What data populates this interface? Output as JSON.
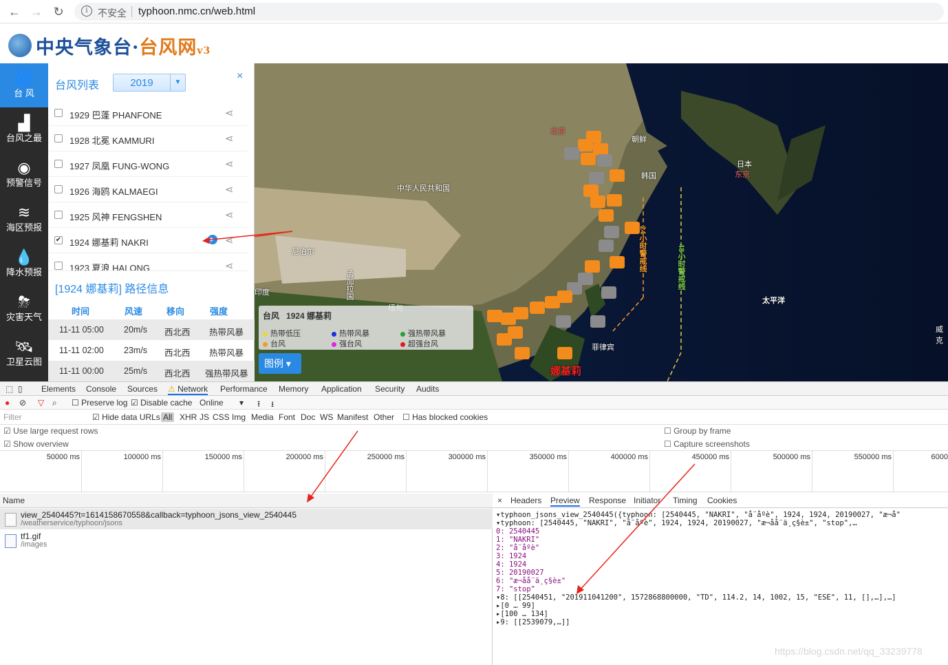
{
  "browser": {
    "insecure_label": "不安全",
    "url": "typhoon.nmc.cn/web.html"
  },
  "site": {
    "logo_main": "中央气象台·",
    "logo_sub": "台风网",
    "logo_ver": "v3"
  },
  "leftnav": [
    {
      "label": "台 风",
      "icon": "typhoon-icon"
    },
    {
      "label": "台风之最",
      "icon": "bar-chart-icon"
    },
    {
      "label": "预警信号",
      "icon": "warning-icon"
    },
    {
      "label": "海区预报",
      "icon": "sea-icon"
    },
    {
      "label": "降水预报",
      "icon": "rain-icon"
    },
    {
      "label": "灾害天气",
      "icon": "disaster-icon"
    },
    {
      "label": "卫星云图",
      "icon": "satellite-icon"
    }
  ],
  "panel": {
    "title": "台风列表",
    "year": "2019",
    "close": "×",
    "typhoons": [
      {
        "label": "1929 巴蓬 PHANFONE",
        "checked": false
      },
      {
        "label": "1928 北冕 KAMMURI",
        "checked": false
      },
      {
        "label": "1927 凤凰 FUNG-WONG",
        "checked": false
      },
      {
        "label": "1926 海鸥 KALMAEGI",
        "checked": false
      },
      {
        "label": "1925 风神 FENGSHEN",
        "checked": false
      },
      {
        "label": "1924 娜基莉 NAKRI",
        "checked": true
      },
      {
        "label": "1923 夏浪 HALONG",
        "checked": false
      }
    ],
    "route_title": "[1924 娜基莉] 路径信息",
    "route_headers": [
      "时间",
      "风速",
      "移向",
      "强度"
    ],
    "route_rows": [
      [
        "11-11 05:00",
        "20m/s",
        "西北西",
        "热带风暴"
      ],
      [
        "11-11 02:00",
        "23m/s",
        "西北西",
        "热带风暴"
      ],
      [
        "11-11 00:00",
        "25m/s",
        "西北西",
        "强热带风暴"
      ]
    ]
  },
  "map": {
    "labels": {
      "beijing": "北京",
      "chaoxian": "朝鲜",
      "hanguo": "韩国",
      "riben": "日本",
      "dongjing": "东京",
      "china": "中华人民共和国",
      "nepal": "尼泊尔",
      "india": "印度",
      "bangladesh": "孟加拉国",
      "myanmar": "缅甸",
      "philippines": "菲律宾",
      "pacific": "太平洋",
      "nakri": "娜基莉",
      "weike": "威克",
      "line24": "24小时警戒线",
      "line48": "48小时警戒线"
    },
    "legend": {
      "header": "台风",
      "name": "1924 娜基莉",
      "items": [
        {
          "label": "热带低压",
          "color": "#e9d83a"
        },
        {
          "label": "热带风暴",
          "color": "#1d2ee0"
        },
        {
          "label": "强热带风暴",
          "color": "#27a03a"
        },
        {
          "label": "台风",
          "color": "#f39a2c"
        },
        {
          "label": "强台风",
          "color": "#e024e0"
        },
        {
          "label": "超强台风",
          "color": "#e01c1c"
        }
      ],
      "button": "图例"
    }
  },
  "devtools": {
    "tabs": [
      "Elements",
      "Console",
      "Sources",
      "Network",
      "Performance",
      "Memory",
      "Application",
      "Security",
      "Audits"
    ],
    "active_tab": "Network",
    "toolbar": {
      "preserve_log": "Preserve log",
      "disable_cache": "Disable cache",
      "online": "Online"
    },
    "filter": {
      "placeholder": "Filter",
      "hide_data_urls": "Hide data URLs",
      "types": [
        "All",
        "XHR",
        "JS",
        "CSS",
        "Img",
        "Media",
        "Font",
        "Doc",
        "WS",
        "Manifest",
        "Other"
      ],
      "blocked": "Has blocked cookies"
    },
    "options": {
      "large_rows": "Use large request rows",
      "overview": "Show overview",
      "group_frame": "Group by frame",
      "capture": "Capture screenshots"
    },
    "timeline_ticks": [
      "50000 ms",
      "100000 ms",
      "150000 ms",
      "200000 ms",
      "250000 ms",
      "300000 ms",
      "350000 ms",
      "400000 ms",
      "450000 ms",
      "500000 ms",
      "550000 ms",
      "6000"
    ],
    "name_header": "Name",
    "requests": [
      {
        "name": "view_2540445?t=1614158670558&callback=typhoon_jsons_view_2540445",
        "path": "/weatherservice/typhoon/jsons"
      },
      {
        "name": "tf1.gif",
        "path": "/images"
      }
    ],
    "preview_tabs": [
      "×",
      "Headers",
      "Preview",
      "Response",
      "Initiator",
      "Timing",
      "Cookies"
    ],
    "active_preview": "Preview",
    "preview_lines": [
      "▾typhoon_jsons_view_2540445({typhoon: [2540445, \"NAKRI\", \"å¨åºè\", 1924, 1924, 20190027, \"æ¬å\"",
      "  ▾typhoon: [2540445, \"NAKRI\", \"å¨åºè\", 1924, 1924, 20190027, \"æ¬åå¨ä¸ç§è±\", \"stop\",…",
      "    0: 2540445",
      "    1: \"NAKRI\"",
      "    2: \"å¨åºè\"",
      "    3: 1924",
      "    4: 1924",
      "    5: 20190027",
      "    6: \"æ¬åå¨ä¸ç§è±\"",
      "    7: \"stop\"",
      "  ▾8: [[2540451, \"201911041200\", 1572868800000, \"TD\", 114.2, 14, 1002, 15, \"ESE\", 11, [],…],…]",
      "     ▸[0 … 99]",
      "     ▸[100 … 134]",
      "  ▸9: [[2539079,…]]"
    ]
  },
  "watermark": "https://blog.csdn.net/qq_33239778"
}
